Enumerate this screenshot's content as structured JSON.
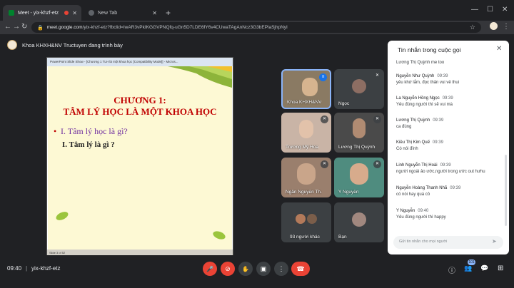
{
  "browser": {
    "tabs": [
      {
        "title": "Meet - yix-khzf-etz",
        "active": true
      },
      {
        "title": "New Tab",
        "active": false
      }
    ],
    "url_host": "meet.google.com",
    "url_path": "/yix-khzf-etz?fbclid=IwAR3vPkIKGGVPNQfq-uGn5D7LDE6fY6v4CUwaTAgAnNcz3G3bEPlaSjhpNyI"
  },
  "meet": {
    "presenting_text": "Khoa KHXH&NV Tructuyen đang trình bày",
    "meeting_code": "yix-khzf-etz",
    "time": "09:40",
    "participant_count": "101"
  },
  "slide": {
    "window_title": "PowerPoint Slide Show - [Chương 1 TLH là một khoa học [Compatibility Mode]] - Micros...",
    "title_line1": "CHƯƠNG 1:",
    "title_line2": "TÂM LÝ HỌC LÀ MỘT KHOA HỌC",
    "bullet_marker": "•",
    "bullet1": "I. Tâm lý học là gì?",
    "bullet2": "I.  Tâm lý là gì ?",
    "status": "Slide 3 of 52"
  },
  "tiles": [
    {
      "name": "Khoa KHXH&NV",
      "active": true
    },
    {
      "name": "Ngọc"
    },
    {
      "name": "Trương Mỹ Hoa"
    },
    {
      "name": "Lương Thị Quỳnh"
    },
    {
      "name": "Ngân Nguyễn Th."
    },
    {
      "name": "Y Nguyễn"
    },
    {
      "name": "93 người khác"
    },
    {
      "name": "Bạn"
    }
  ],
  "chat": {
    "title": "Tin nhắn trong cuộc gọi",
    "input_placeholder": "Gửi tin nhắn cho mọi người",
    "messages": [
      {
        "sender": "",
        "time": "",
        "text": "Lương Thị Quỳnh me too"
      },
      {
        "sender": "Nguyễn Như Quỳnh",
        "time": "09:39",
        "text": "yêu khứ lắm, đọc thân vui vẻ thui"
      },
      {
        "sender": "La Nguyễn Hồng Ngọc",
        "time": "09:39",
        "text": "Yêu đúng người thì sẽ vui mà"
      },
      {
        "sender": "Lương Thị Quỳnh",
        "time": "09:39",
        "text": "ca đúng"
      },
      {
        "sender": "Kiều Thị Kim Quế",
        "time": "09:39",
        "text": "Có nói đính"
      },
      {
        "sender": "Linh Nguyễn Thị Hoài",
        "time": "09:39",
        "text": "người ngoài ảo ước,người trong ước out hưhu"
      },
      {
        "sender": "Nguyễn Hoàng Thanh Nhã",
        "time": "09:39",
        "text": "có nói hay quá cô"
      },
      {
        "sender": "Y Nguyễn",
        "time": "09:40",
        "text": "Yêu đúng người thì happy"
      }
    ]
  },
  "icons": {
    "lock": "🔒",
    "star": "☆",
    "mic_off": "🎤",
    "cam_off": "⊘",
    "hand": "✋",
    "present": "▣",
    "more": "⋮",
    "end_call": "☎",
    "info": "ⓘ",
    "people": "👥",
    "chat": "💬",
    "activities": "⊞",
    "send": "➤",
    "close": "✕"
  },
  "colors": {
    "accent": "#8ab4f8",
    "danger": "#ea4335",
    "slide_title": "#c00000",
    "slide_bullet": "#7030a0"
  }
}
